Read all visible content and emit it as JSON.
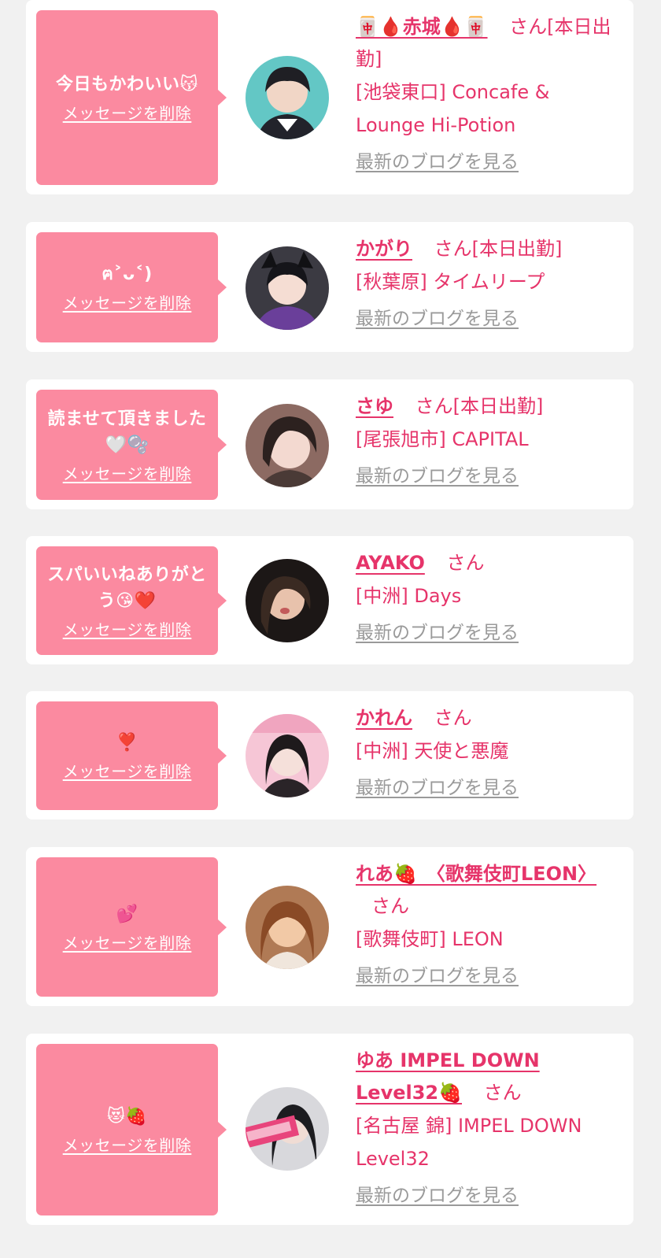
{
  "delete_label": "メッセージを削除",
  "blog_label": "最新のブログを見る",
  "colors": {
    "bubble": "#fb8aa0",
    "accent": "#e6346a",
    "link_gray": "#9a9a9a",
    "page_bg": "#f1f1f1"
  },
  "entries": [
    {
      "message": "今日もかわいい😽",
      "name": "🀄🩸赤城🩸🀄",
      "san": "さん[本日出勤]",
      "shop": "[池袋東口] Concafe & Lounge Hi-Potion"
    },
    {
      "message": "ฅ˃ᴗ˂)",
      "name": "かがり",
      "san": "さん[本日出勤]",
      "shop": "[秋葉原] タイムリープ"
    },
    {
      "message": "読ませて頂きました🤍🫧",
      "name": "さゆ",
      "san": "さん[本日出勤]",
      "shop": "[尾張旭市] CAPITAL"
    },
    {
      "message": "スパいいねありがとう😘❤️",
      "name": "AYAKO",
      "san": "さん",
      "shop": "[中洲] Days"
    },
    {
      "message": "❣️",
      "name": "かれん",
      "san": "さん",
      "shop": "[中洲] 天使と悪魔"
    },
    {
      "message": "💕",
      "name": "れあ🍓　〈歌舞伎町LEON〉",
      "san": "さん",
      "shop": "[歌舞伎町] LEON"
    },
    {
      "message": "😻🍓",
      "name": "ゆあ IMPEL DOWN Level32🍓",
      "san": "さん",
      "shop": "[名古屋 錦] IMPEL DOWN Level32"
    }
  ]
}
